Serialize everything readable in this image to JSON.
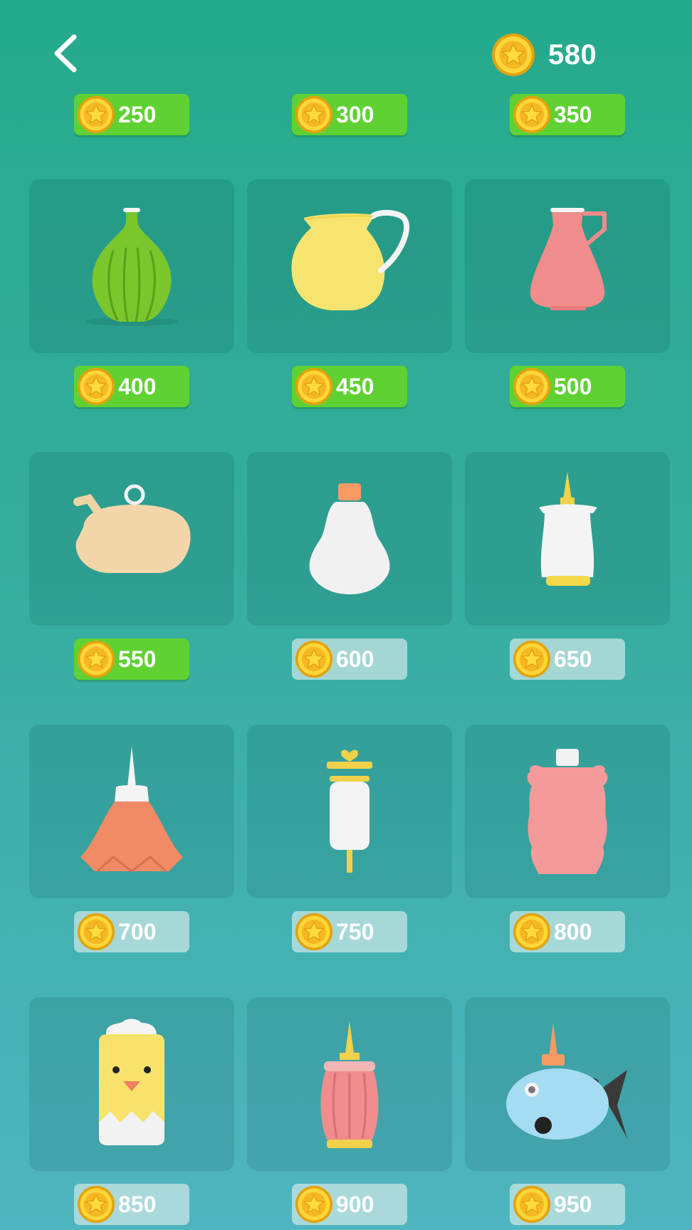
{
  "header": {
    "back_icon": "back-arrow-icon",
    "balance": "580",
    "coin_icon": "star-coin-icon"
  },
  "colors": {
    "unlocked_price": "#5fd132",
    "locked_price": "#cde8e6",
    "coin": "#f7c31a"
  },
  "row0_prices": [
    {
      "price": "250",
      "state": "unlocked"
    },
    {
      "price": "300",
      "state": "unlocked"
    },
    {
      "price": "350",
      "state": "unlocked"
    }
  ],
  "items": [
    {
      "name": "green-round-vase",
      "price": "400",
      "state": "unlocked"
    },
    {
      "name": "yellow-pitcher",
      "price": "450",
      "state": "unlocked"
    },
    {
      "name": "pink-jug",
      "price": "500",
      "state": "unlocked"
    },
    {
      "name": "beige-teapot-bottle",
      "price": "550",
      "state": "unlocked"
    },
    {
      "name": "white-bulb-bottle",
      "price": "600",
      "state": "locked"
    },
    {
      "name": "white-nozzle-bottle",
      "price": "650",
      "state": "locked"
    },
    {
      "name": "orange-nozzle-bottle",
      "price": "700",
      "state": "locked"
    },
    {
      "name": "syringe-bottle",
      "price": "750",
      "state": "locked"
    },
    {
      "name": "pink-bear-bottle",
      "price": "800",
      "state": "locked"
    },
    {
      "name": "chick-bottle",
      "price": "850",
      "state": "locked"
    },
    {
      "name": "pink-ribbed-bottle",
      "price": "900",
      "state": "locked"
    },
    {
      "name": "fish-bottle",
      "price": "950",
      "state": "locked"
    }
  ]
}
